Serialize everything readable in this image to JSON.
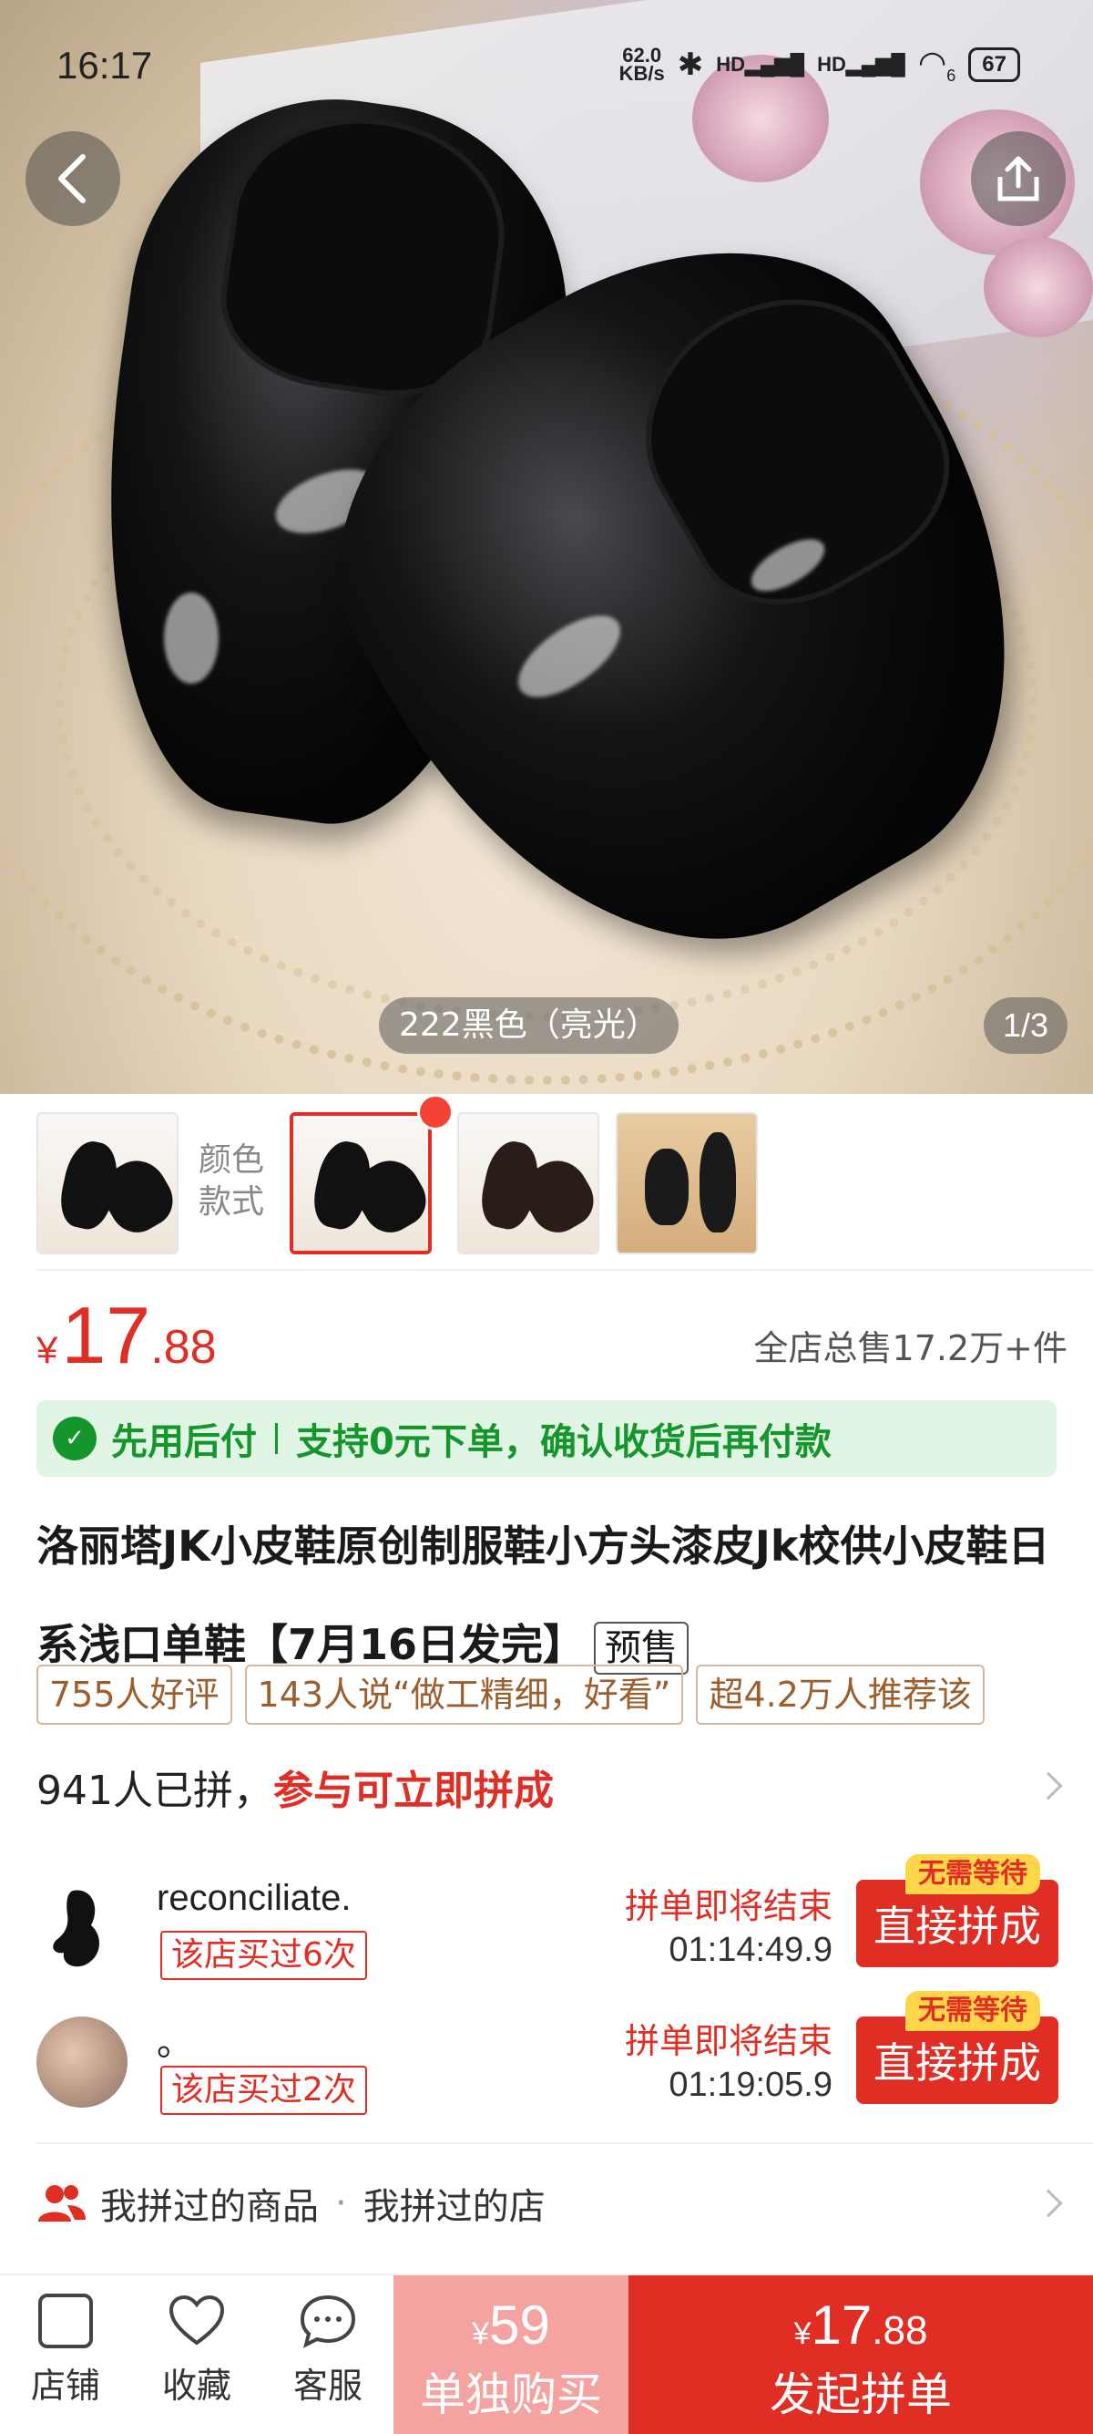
{
  "status_bar": {
    "time": "16:17",
    "net_speed": "62.0\nKB/s",
    "net_speed_top": "62.0",
    "net_speed_bottom": "KB/s",
    "hd1": "HD",
    "hd2": "HD",
    "wifi_num": "6",
    "battery": "67"
  },
  "gallery": {
    "variant_tag": "222黑色（亮光）",
    "index": "1/3",
    "color_label_1": "颜色",
    "color_label_2": "款式"
  },
  "price": {
    "currency": "¥",
    "integer": "17",
    "decimal": ".88",
    "total_sold": "全店总售17.2万+件"
  },
  "pay_later": {
    "label": "先用后付",
    "desc": "支持0元下单，确认收货后再付款"
  },
  "product": {
    "title": "洛丽塔JK小皮鞋原创制服鞋小方头漆皮Jk校供小皮鞋日系浅口单鞋【7月16日发完】",
    "presale": "预售"
  },
  "review_tags": [
    "755人好评",
    "143人说“做工精细，好看”",
    "超4.2万人推荐该"
  ],
  "group_buy": {
    "count_text": "941人已拼，",
    "cta_text": "参与可立即拼成",
    "entries": [
      {
        "name": "reconciliate.",
        "bought": "该店买过6次",
        "ending": "拼单即将结束",
        "timer": "01:14:49.9",
        "badge": "无需等待",
        "button": "直接拼成"
      },
      {
        "name": "。",
        "bought": "该店买过2次",
        "ending": "拼单即将结束",
        "timer": "01:19:05.9",
        "badge": "无需等待",
        "button": "直接拼成"
      }
    ]
  },
  "history": {
    "goods": "我拼过的商品",
    "dot": "·",
    "shops": "我拼过的店"
  },
  "bottom_bar": {
    "store": "店铺",
    "favorite": "收藏",
    "service": "客服",
    "alone_currency": "¥",
    "alone_price": "59",
    "alone_label": "单独购买",
    "group_currency": "¥",
    "group_price_int": "17",
    "group_price_dec": ".88",
    "group_label": "发起拼单"
  },
  "colors": {
    "accent_red": "#e02e24",
    "green": "#15962c",
    "pink_button": "#f5a3a1"
  }
}
